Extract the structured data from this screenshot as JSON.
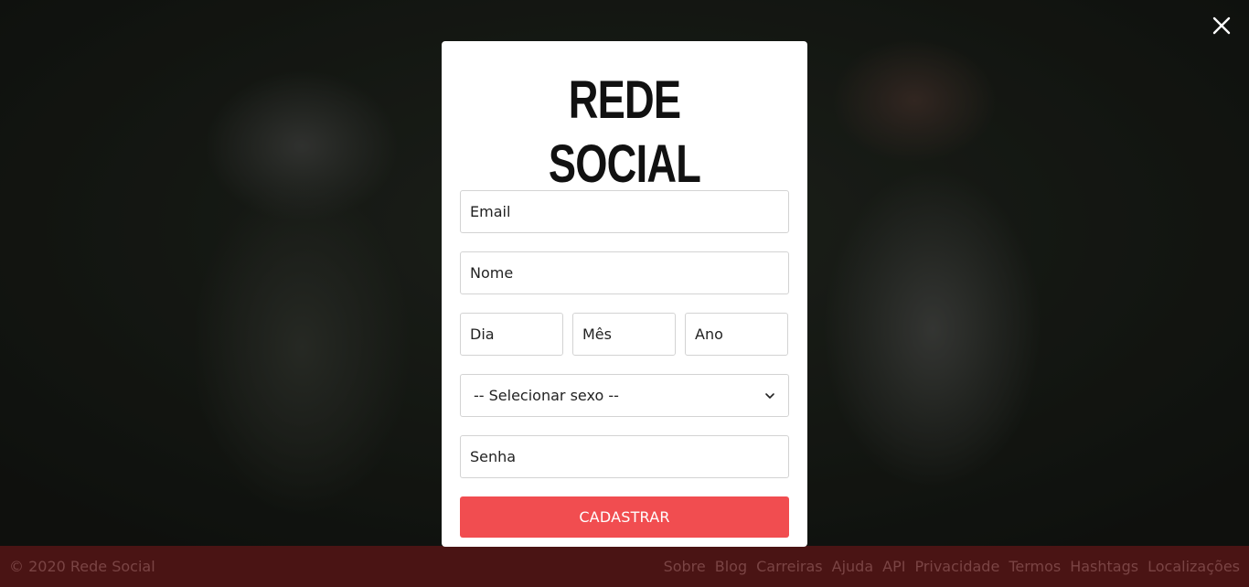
{
  "modal": {
    "logo": "REDE SOCIAL",
    "fields": {
      "email_placeholder": "Email",
      "name_placeholder": "Nome",
      "day_placeholder": "Dia",
      "month_placeholder": "Mês",
      "year_placeholder": "Ano",
      "password_placeholder": "Senha"
    },
    "gender_select": {
      "selected": "-- Selecionar sexo --"
    },
    "submit_label": "CADASTRAR"
  },
  "close_icon": "close-icon",
  "footer": {
    "copyright": "© 2020 Rede Social",
    "links": [
      "Sobre",
      "Blog",
      "Carreiras",
      "Ajuda",
      "API",
      "Privacidade",
      "Termos",
      "Hashtags",
      "Localizações"
    ]
  },
  "colors": {
    "accent": "#f14d50",
    "footer_bg": "#4a1414"
  }
}
